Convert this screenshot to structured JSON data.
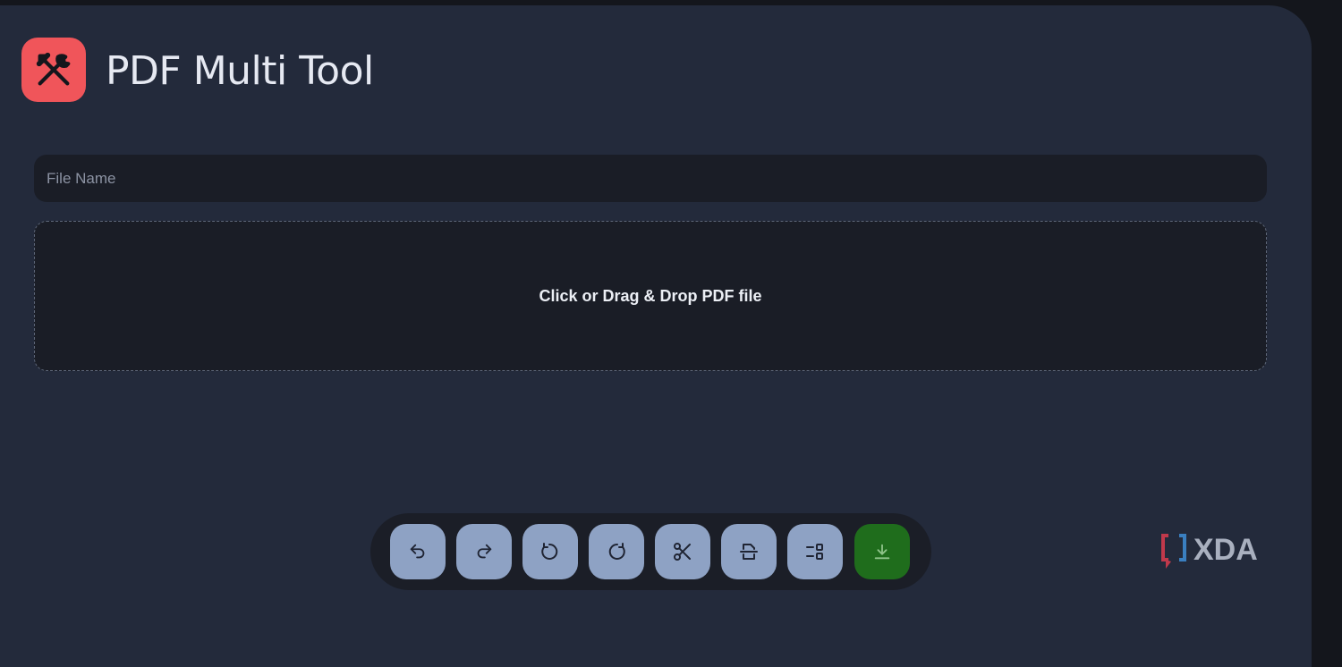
{
  "app": {
    "title": "PDF Multi Tool",
    "icon": "hammer-wrench-icon",
    "accent_color": "#f0555a"
  },
  "file_name_input": {
    "value": "",
    "placeholder": "File Name"
  },
  "dropzone": {
    "label": "Click or Drag & Drop PDF file"
  },
  "toolbar": {
    "buttons": [
      {
        "name": "undo",
        "icon": "undo-icon"
      },
      {
        "name": "redo",
        "icon": "redo-icon"
      },
      {
        "name": "rotate-left",
        "icon": "rotate-counterclockwise-icon"
      },
      {
        "name": "rotate-right",
        "icon": "rotate-clockwise-icon"
      },
      {
        "name": "split",
        "icon": "scissors-icon"
      },
      {
        "name": "split-page",
        "icon": "page-split-icon"
      },
      {
        "name": "layout",
        "icon": "layout-icon"
      },
      {
        "name": "download",
        "icon": "download-icon"
      }
    ],
    "button_color": "#8ea2c4",
    "download_color": "#1f6d1c"
  },
  "watermark": {
    "text": "XDA"
  }
}
